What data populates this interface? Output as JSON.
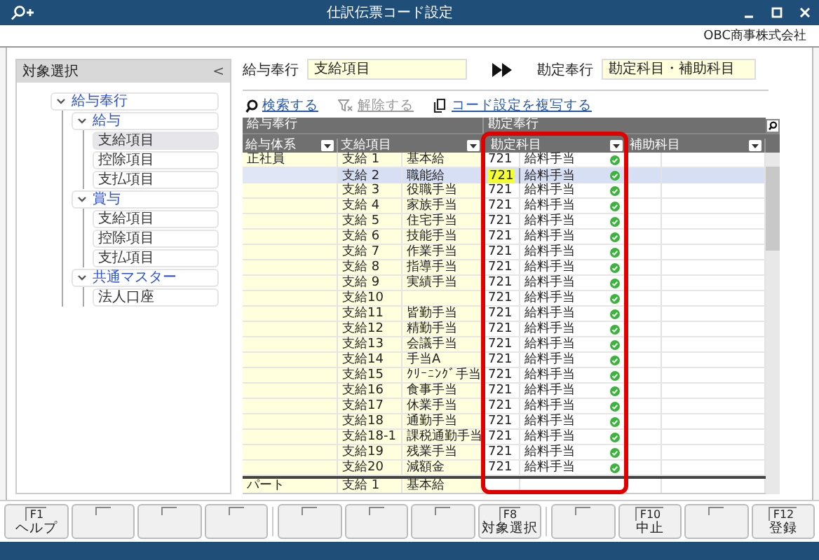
{
  "window": {
    "title": "仕訳伝票コード設定",
    "company": "OBC商事株式会社"
  },
  "sidebar": {
    "title": "対象選択",
    "collapse": "<",
    "tree": [
      {
        "label": "給与奉行",
        "expanded": true,
        "children": [
          {
            "label": "給与",
            "expanded": true,
            "children": [
              {
                "label": "支給項目",
                "selected": true
              },
              {
                "label": "控除項目",
                "selected": false
              },
              {
                "label": "支払項目",
                "selected": false
              }
            ]
          },
          {
            "label": "賞与",
            "expanded": true,
            "children": [
              {
                "label": "支給項目",
                "selected": false
              },
              {
                "label": "控除項目",
                "selected": false
              },
              {
                "label": "支払項目",
                "selected": false
              }
            ]
          },
          {
            "label": "共通マスター",
            "expanded": true,
            "children": [
              {
                "label": "法人口座",
                "selected": false
              }
            ]
          }
        ]
      }
    ]
  },
  "mapping": {
    "source_label": "給与奉行",
    "source_value": "支給項目",
    "target_label": "勘定奉行",
    "target_value": "勘定科目・補助科目"
  },
  "toolbar": [
    {
      "label": "検索する",
      "kind": "search",
      "disabled": false
    },
    {
      "label": "解除する",
      "kind": "clear",
      "disabled": true
    },
    {
      "label": "コード設定を複写する",
      "kind": "copy",
      "disabled": false
    }
  ],
  "table": {
    "groups": [
      "給与奉行",
      "勘定奉行"
    ],
    "columns": [
      "給与体系",
      "支給項目",
      "勘定科目",
      "補助科目"
    ],
    "sections": [
      {
        "system": "正社員",
        "rows": [
          {
            "code": "支給 1",
            "name": "基本給",
            "account_code": "721",
            "account_name": "給料手当",
            "ok": true,
            "selected": false
          },
          {
            "code": "支給 2",
            "name": "職能給",
            "account_code": "721",
            "account_name": "給料手当",
            "ok": true,
            "selected": true
          },
          {
            "code": "支給 3",
            "name": "役職手当",
            "account_code": "721",
            "account_name": "給料手当",
            "ok": true,
            "selected": false
          },
          {
            "code": "支給 4",
            "name": "家族手当",
            "account_code": "721",
            "account_name": "給料手当",
            "ok": true,
            "selected": false
          },
          {
            "code": "支給 5",
            "name": "住宅手当",
            "account_code": "721",
            "account_name": "給料手当",
            "ok": true,
            "selected": false
          },
          {
            "code": "支給 6",
            "name": "技能手当",
            "account_code": "721",
            "account_name": "給料手当",
            "ok": true,
            "selected": false
          },
          {
            "code": "支給 7",
            "name": "作業手当",
            "account_code": "721",
            "account_name": "給料手当",
            "ok": true,
            "selected": false
          },
          {
            "code": "支給 8",
            "name": "指導手当",
            "account_code": "721",
            "account_name": "給料手当",
            "ok": true,
            "selected": false
          },
          {
            "code": "支給 9",
            "name": "実績手当",
            "account_code": "721",
            "account_name": "給料手当",
            "ok": true,
            "selected": false
          },
          {
            "code": "支給10",
            "account_code": "721",
            "account_name": "給料手当",
            "ok": true,
            "selected": false
          },
          {
            "code": "支給11",
            "name": "皆勤手当",
            "account_code": "721",
            "account_name": "給料手当",
            "ok": true,
            "selected": false
          },
          {
            "code": "支給12",
            "name": "精勤手当",
            "account_code": "721",
            "account_name": "給料手当",
            "ok": true,
            "selected": false
          },
          {
            "code": "支給13",
            "name": "会議手当",
            "account_code": "721",
            "account_name": "給料手当",
            "ok": true,
            "selected": false
          },
          {
            "code": "支給14",
            "name": "手当A",
            "account_code": "721",
            "account_name": "給料手当",
            "ok": true,
            "selected": false
          },
          {
            "code": "支給15",
            "name": "ｸﾘｰﾆﾝｸﾞ手当",
            "account_code": "721",
            "account_name": "給料手当",
            "ok": true,
            "selected": false
          },
          {
            "code": "支給16",
            "name": "食事手当",
            "account_code": "721",
            "account_name": "給料手当",
            "ok": true,
            "selected": false
          },
          {
            "code": "支給17",
            "name": "休業手当",
            "account_code": "721",
            "account_name": "給料手当",
            "ok": true,
            "selected": false
          },
          {
            "code": "支給18",
            "name": "通勤手当",
            "account_code": "721",
            "account_name": "給料手当",
            "ok": true,
            "selected": false
          },
          {
            "code": "支給18-1",
            "name": "課税通勤手当",
            "account_code": "721",
            "account_name": "給料手当",
            "ok": true,
            "selected": false
          },
          {
            "code": "支給19",
            "name": "残業手当",
            "account_code": "721",
            "account_name": "給料手当",
            "ok": true,
            "selected": false
          },
          {
            "code": "支給20",
            "name": "減額金",
            "account_code": "721",
            "account_name": "給料手当",
            "ok": true,
            "selected": false
          }
        ]
      },
      {
        "system": "パート",
        "rows": [
          {
            "code": "支給 1",
            "name": "基本給",
            "ok": false,
            "selected": false
          }
        ]
      }
    ]
  },
  "function_keys": [
    {
      "kind": "key",
      "key": "F1",
      "label": "ヘルプ"
    },
    {
      "kind": "blank"
    },
    {
      "kind": "blank"
    },
    {
      "kind": "blank"
    },
    {
      "kind": "blank"
    },
    {
      "kind": "blank"
    },
    {
      "kind": "blank"
    },
    {
      "kind": "key",
      "key": "F8",
      "label": "対象選択"
    },
    {
      "kind": "blank"
    },
    {
      "kind": "key",
      "key": "F10",
      "label": "中止"
    },
    {
      "kind": "blank"
    },
    {
      "kind": "key",
      "key": "F12",
      "label": "登録"
    }
  ]
}
